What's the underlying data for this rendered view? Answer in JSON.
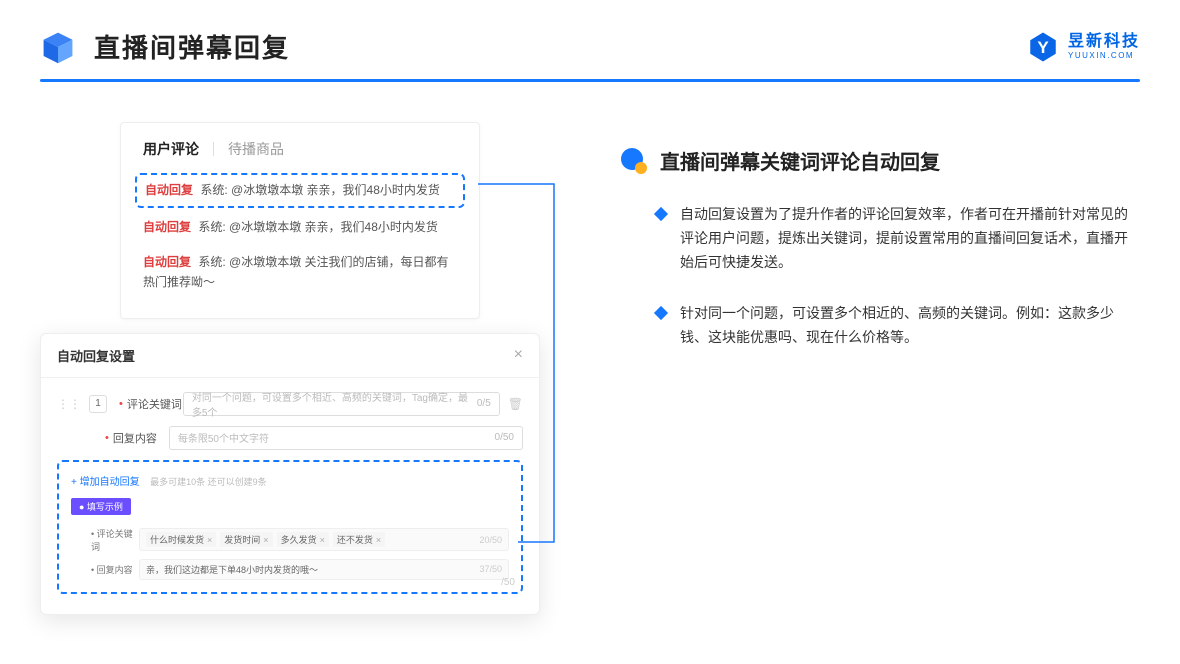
{
  "header": {
    "title": "直播间弹幕回复",
    "logo_cn": "昱新科技",
    "logo_en": "YUUXIN.COM"
  },
  "comments": {
    "tab_active": "用户评论",
    "tab_inactive": "待播商品",
    "items": [
      {
        "tag": "自动回复",
        "text": "系统: @冰墩墩本墩 亲亲，我们48小时内发货"
      },
      {
        "tag": "自动回复",
        "text": "系统: @冰墩墩本墩 亲亲，我们48小时内发货"
      },
      {
        "tag": "自动回复",
        "text": "系统: @冰墩墩本墩 关注我们的店铺，每日都有热门推荐呦～"
      }
    ]
  },
  "settings": {
    "title": "自动回复设置",
    "num": "1",
    "kw_label": "评论关键词",
    "kw_placeholder": "对同一个问题，可设置多个相近、高频的关键词，Tag确定，最多5个",
    "kw_count": "0/5",
    "content_label": "回复内容",
    "content_placeholder": "每条限50个中文字符",
    "content_count": "0/50",
    "add_link": "+ 增加自动回复",
    "add_note": "最多可建10条 还可以创建9条",
    "example_badge": "● 填写示例",
    "eg_kw_label": "• 评论关键词",
    "eg_tags": [
      "什么时候发货",
      "发货时间",
      "多久发货",
      "还不发货"
    ],
    "eg_kw_count": "20/50",
    "eg_content_label": "• 回复内容",
    "eg_content_text": "亲，我们这边都是下单48小时内发货的哦～",
    "eg_content_count": "37/50",
    "extra_count": "/50"
  },
  "feature": {
    "title": "直播间弹幕关键词评论自动回复",
    "bullets": [
      "自动回复设置为了提升作者的评论回复效率，作者可在开播前针对常见的评论用户问题，提炼出关键词，提前设置常用的直播间回复话术，直播开始后可快捷发送。",
      "针对同一个问题，可设置多个相近的、高频的关键词。例如：这款多少钱、这块能优惠吗、现在什么价格等。"
    ]
  }
}
